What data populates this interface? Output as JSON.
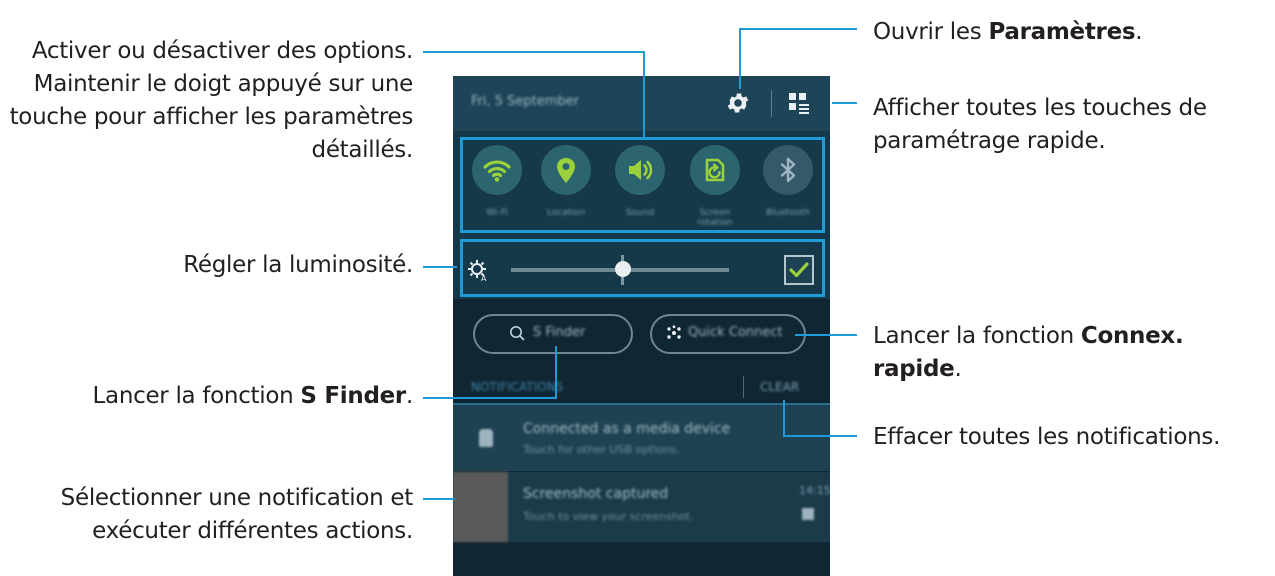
{
  "callouts": {
    "toggle_options": {
      "line1": "Activer ou désactiver des options.",
      "line2": "Maintenir le doigt appuyé sur une",
      "line3": "touche pour afficher les paramètres",
      "line4": "détaillés."
    },
    "open_settings": {
      "prefix": "Ouvrir les ",
      "bold": "Paramètres",
      "suffix": "."
    },
    "show_all_quick": {
      "line1": "Afficher toutes les touches de",
      "line2": "paramétrage rapide."
    },
    "brightness": {
      "text": "Régler la luminosité."
    },
    "quick_connect": {
      "prefix": "Lancer la fonction ",
      "bold": "Connex. rapide",
      "suffix": "."
    },
    "s_finder": {
      "prefix": "Lancer la fonction ",
      "bold": "S Finder",
      "suffix": "."
    },
    "clear_notifications": {
      "text": "Effacer toutes les notifications."
    },
    "select_notification": {
      "line1": "Sélectionner une notification et",
      "line2": "exécuter différentes actions."
    }
  },
  "phone": {
    "date": "Fri, 5 September",
    "quick_buttons": [
      {
        "label": "Wi-Fi",
        "icon": "wifi-icon",
        "state": "on"
      },
      {
        "label": "Location",
        "icon": "location-icon",
        "state": "on"
      },
      {
        "label": "Sound",
        "icon": "sound-icon",
        "state": "on"
      },
      {
        "label": "Screen rotation",
        "icon": "rotation-icon",
        "state": "on"
      },
      {
        "label": "Bluetooth",
        "icon": "bluetooth-icon",
        "state": "off"
      }
    ],
    "brightness": {
      "level": 0.48,
      "auto_label": "Auto",
      "auto_checked": true
    },
    "s_finder_label": "S Finder",
    "quick_connect_label": "Quick Connect",
    "notifications_header": "NOTIFICATIONS",
    "clear_label": "CLEAR",
    "notifications": [
      {
        "title": "Connected as a media device",
        "subtitle": "Touch for other USB options."
      },
      {
        "title": "Screenshot captured",
        "subtitle": "Touch to view your screenshot.",
        "time": "14:15"
      }
    ]
  },
  "colors": {
    "accent_line": "#1f9bd7",
    "toggle_on": "#9bd13a",
    "panel_bg": "#15384a",
    "dark_bg": "#102632"
  }
}
